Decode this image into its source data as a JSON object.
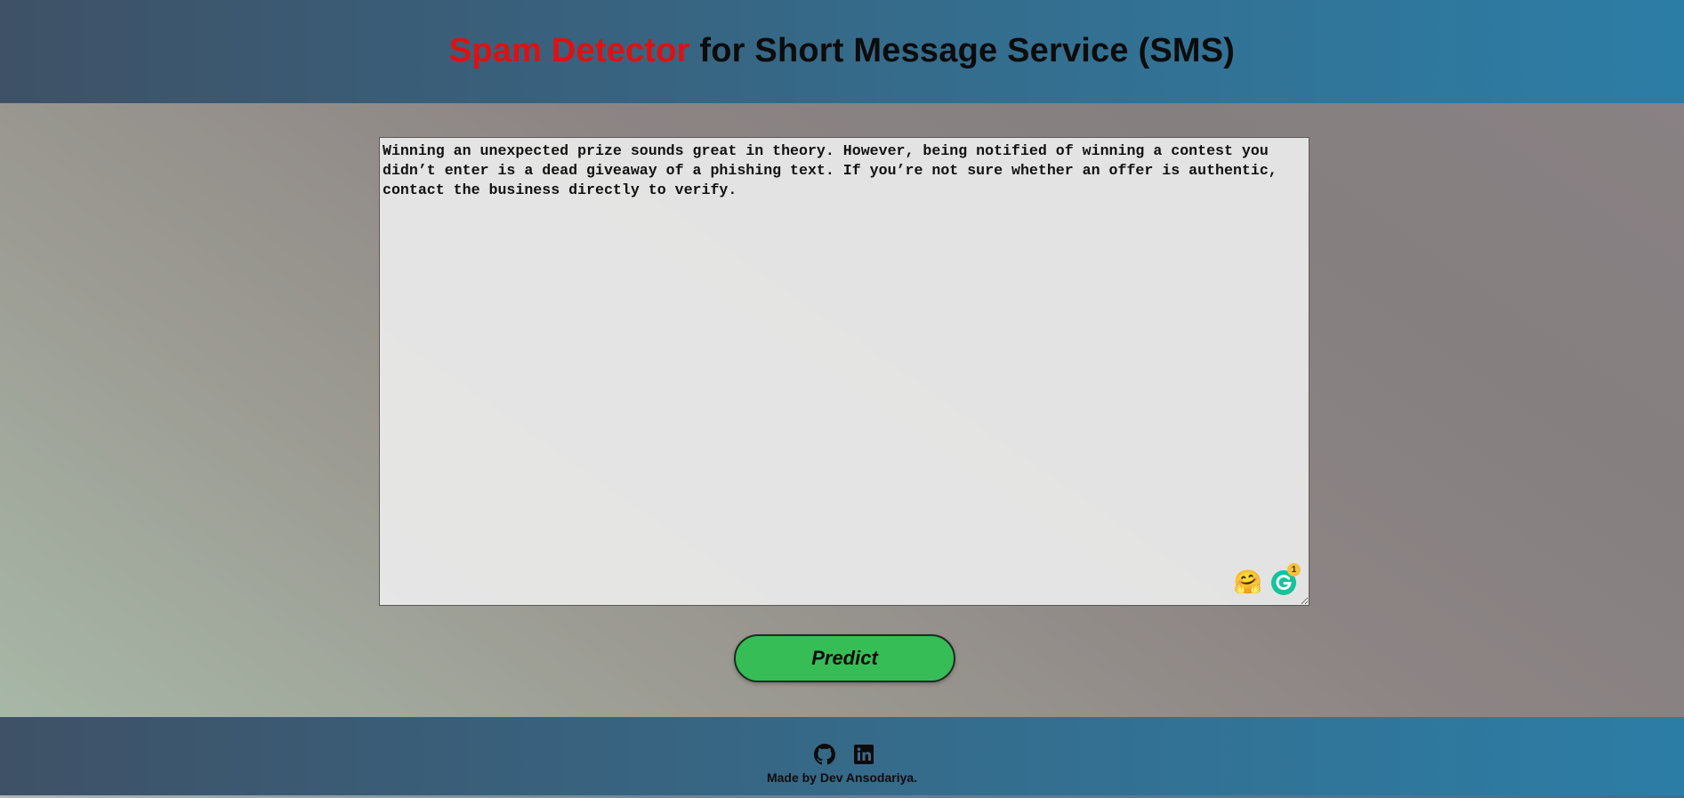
{
  "header": {
    "title_accent": "Spam Detector",
    "title_rest": " for Short Message Service (SMS)",
    "accent_color": "#e01010"
  },
  "message": {
    "value": "Winning an unexpected prize sounds great in theory. However, being notified of winning a contest you didn’t enter is a dead giveaway of a phishing text. If you’re not sure whether an offer is authentic, contact the business directly to verify."
  },
  "extensions": {
    "emoji_icon": "hugging-face-icon",
    "emoji_glyph": "🤗",
    "grammar_icon": "grammarly-icon",
    "grammar_badge_count": "1"
  },
  "actions": {
    "predict_label": "Predict",
    "predict_color": "#37bd55"
  },
  "footer": {
    "github_icon": "github-icon",
    "linkedin_icon": "linkedin-icon",
    "credit": "Made by Dev Ansodariya."
  }
}
